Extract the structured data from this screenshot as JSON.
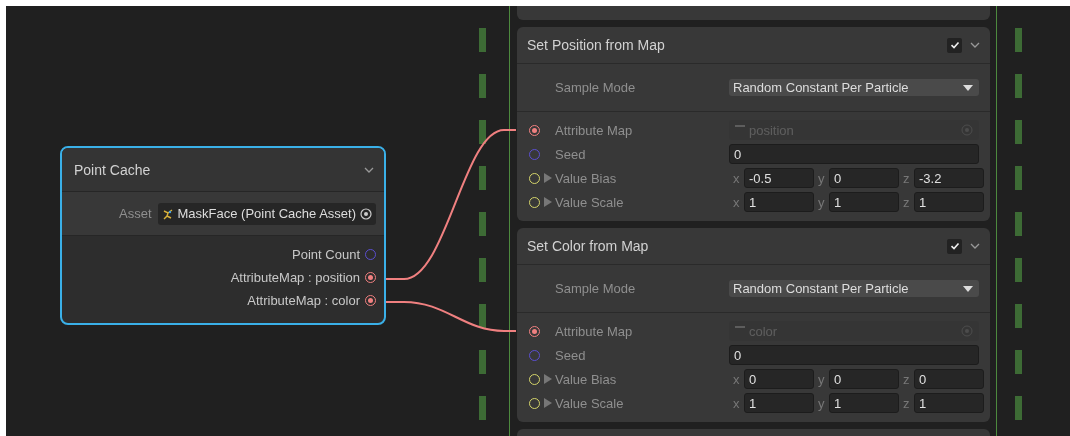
{
  "point_cache": {
    "title": "Point Cache",
    "expanded": true,
    "asset_label": "Asset",
    "asset_value": "MaskFace (Point Cache Asset)",
    "outputs": [
      {
        "label": "Point Count",
        "kind": "uint",
        "connected": false
      },
      {
        "label": "AttributeMap : position",
        "kind": "texture",
        "connected": true
      },
      {
        "label": "AttributeMap : color",
        "kind": "texture",
        "connected": true
      }
    ]
  },
  "blocks": [
    {
      "title": "Set Position from Map",
      "enabled": true,
      "expanded": true,
      "sample_mode_label": "Sample Mode",
      "sample_mode": "Random Constant Per Particle",
      "inputs": [
        {
          "kind": "texture",
          "label": "Attribute Map",
          "connected": true,
          "disabled": true,
          "value": "position"
        },
        {
          "kind": "uint",
          "label": "Seed",
          "connected": false,
          "value": "0"
        },
        {
          "kind": "vector3",
          "label": "Value Bias",
          "connected": false,
          "components": [
            {
              "axis": "x",
              "value": "-0.5"
            },
            {
              "axis": "y",
              "value": "0"
            },
            {
              "axis": "z",
              "value": "-3.2"
            }
          ]
        },
        {
          "kind": "vector3",
          "label": "Value Scale",
          "connected": false,
          "components": [
            {
              "axis": "x",
              "value": "1"
            },
            {
              "axis": "y",
              "value": "1"
            },
            {
              "axis": "z",
              "value": "1"
            }
          ]
        }
      ]
    },
    {
      "title": "Set Color from Map",
      "enabled": true,
      "expanded": true,
      "sample_mode_label": "Sample Mode",
      "sample_mode": "Random Constant Per Particle",
      "inputs": [
        {
          "kind": "texture",
          "label": "Attribute Map",
          "connected": true,
          "disabled": true,
          "value": "color"
        },
        {
          "kind": "uint",
          "label": "Seed",
          "connected": false,
          "value": "0"
        },
        {
          "kind": "vector3",
          "label": "Value Bias",
          "connected": false,
          "components": [
            {
              "axis": "x",
              "value": "0"
            },
            {
              "axis": "y",
              "value": "0"
            },
            {
              "axis": "z",
              "value": "0"
            }
          ]
        },
        {
          "kind": "vector3",
          "label": "Value Scale",
          "connected": false,
          "components": [
            {
              "axis": "x",
              "value": "1"
            },
            {
              "axis": "y",
              "value": "1"
            },
            {
              "axis": "z",
              "value": "1"
            }
          ]
        }
      ]
    }
  ]
}
